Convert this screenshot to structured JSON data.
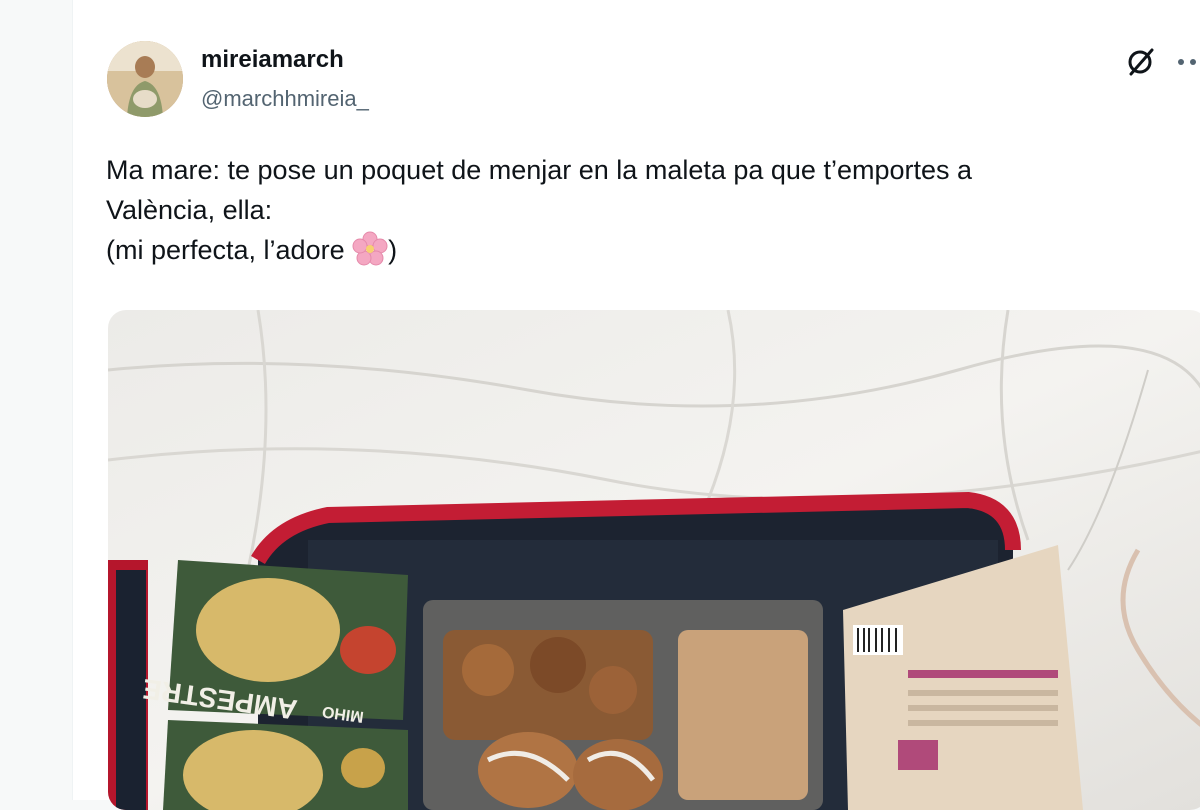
{
  "author": {
    "display_name": "mireiamarch",
    "handle": "@marchhmireia_"
  },
  "icons": {
    "grok": "grok-icon",
    "more": "more-options-icon",
    "emoji": "cherry-blossom-icon"
  },
  "tweet": {
    "text_line1": "Ma mare: te pose un poquet de menjar en la maleta pa que t’emportes a",
    "text_line2": "València, ella:",
    "text_line3": "(mi perfecta, l’adore ",
    "text_line3_end": ")"
  },
  "photo": {
    "package_left_label": "AMPESTRE",
    "package_left_sub": "MIHO"
  }
}
